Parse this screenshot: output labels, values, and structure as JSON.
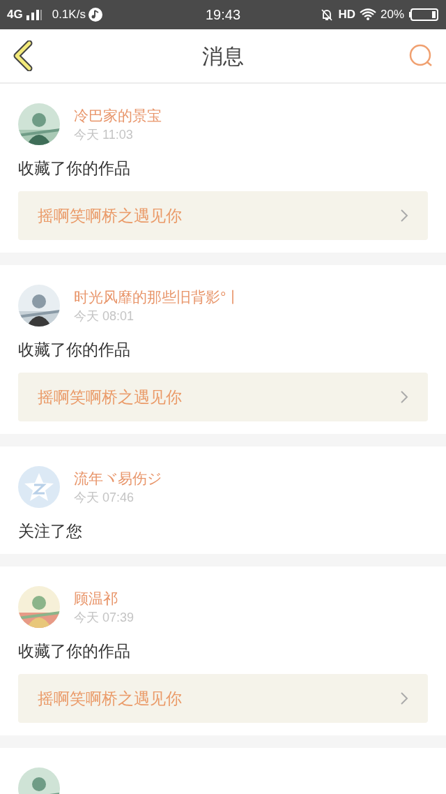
{
  "status_bar": {
    "network": "4G",
    "speed": "0.1K/s",
    "time": "19:43",
    "hd": "HD",
    "battery": "20%"
  },
  "header": {
    "title": "消息"
  },
  "messages": [
    {
      "avatar": {
        "kind": "picture"
      },
      "name": "冷巴家的景宝",
      "time": "今天 11:03",
      "action": "收藏了你的作品",
      "work": "摇啊笑啊桥之遇见你"
    },
    {
      "avatar": {
        "kind": "picture"
      },
      "name": "时光风靡的那些旧背影°丨",
      "time": "今天 08:01",
      "action": "收藏了你的作品",
      "work": "摇啊笑啊桥之遇见你"
    },
    {
      "avatar": {
        "kind": "default"
      },
      "name": "流年ヾ易伤ジ",
      "time": "今天 07:46",
      "action": "关注了您"
    },
    {
      "avatar": {
        "kind": "picture"
      },
      "name": "顾温祁",
      "time": "今天 07:39",
      "action": "收藏了你的作品",
      "work": "摇啊笑啊桥之遇见你"
    },
    {
      "avatar": {
        "kind": "picture"
      }
    }
  ]
}
